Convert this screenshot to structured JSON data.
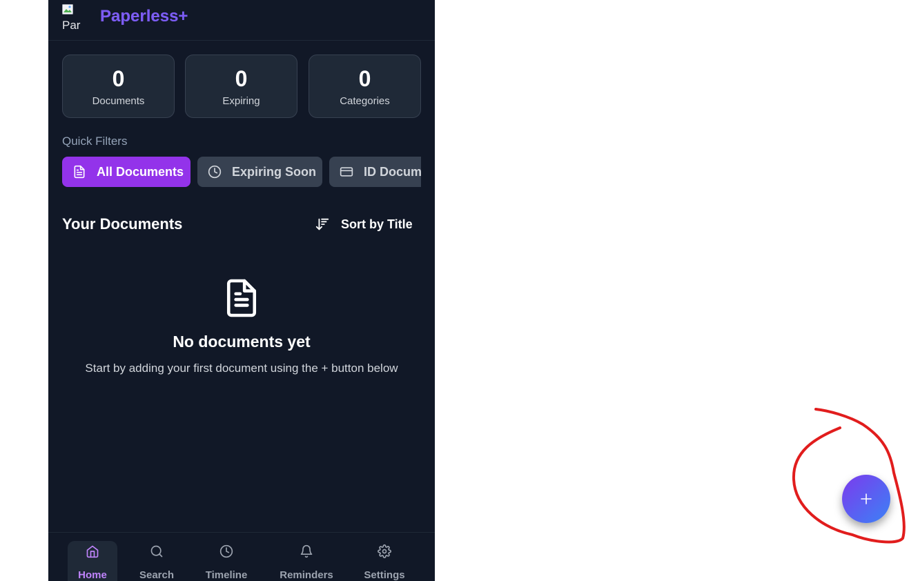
{
  "header": {
    "logo_alt": "Par",
    "title": "Paperless+"
  },
  "stats": [
    {
      "value": "0",
      "label": "Documents"
    },
    {
      "value": "0",
      "label": "Expiring"
    },
    {
      "value": "0",
      "label": "Categories"
    }
  ],
  "quick_filters": {
    "label": "Quick Filters",
    "chips": [
      {
        "label": "All Documents",
        "icon": "file-text-icon",
        "active": true
      },
      {
        "label": "Expiring Soon",
        "icon": "clock-icon",
        "active": false
      },
      {
        "label": "ID Documents",
        "icon": "id-card-icon",
        "active": false
      }
    ]
  },
  "documents": {
    "title": "Your Documents",
    "sort_label": "Sort by Title",
    "empty_title": "No documents yet",
    "empty_subtitle": "Start by adding your first document using the + button below"
  },
  "nav": [
    {
      "label": "Home",
      "icon": "home-icon",
      "active": true
    },
    {
      "label": "Search",
      "icon": "search-icon",
      "active": false
    },
    {
      "label": "Timeline",
      "icon": "clock-icon",
      "active": false
    },
    {
      "label": "Reminders",
      "icon": "bell-icon",
      "active": false
    },
    {
      "label": "Settings",
      "icon": "gear-icon",
      "active": false
    }
  ],
  "fab": {
    "icon": "plus-icon"
  },
  "colors": {
    "background": "#111827",
    "card": "#1f2937",
    "accent": "#9333ea",
    "nav_active": "#c084fc",
    "annotation": "#e11d1d"
  }
}
